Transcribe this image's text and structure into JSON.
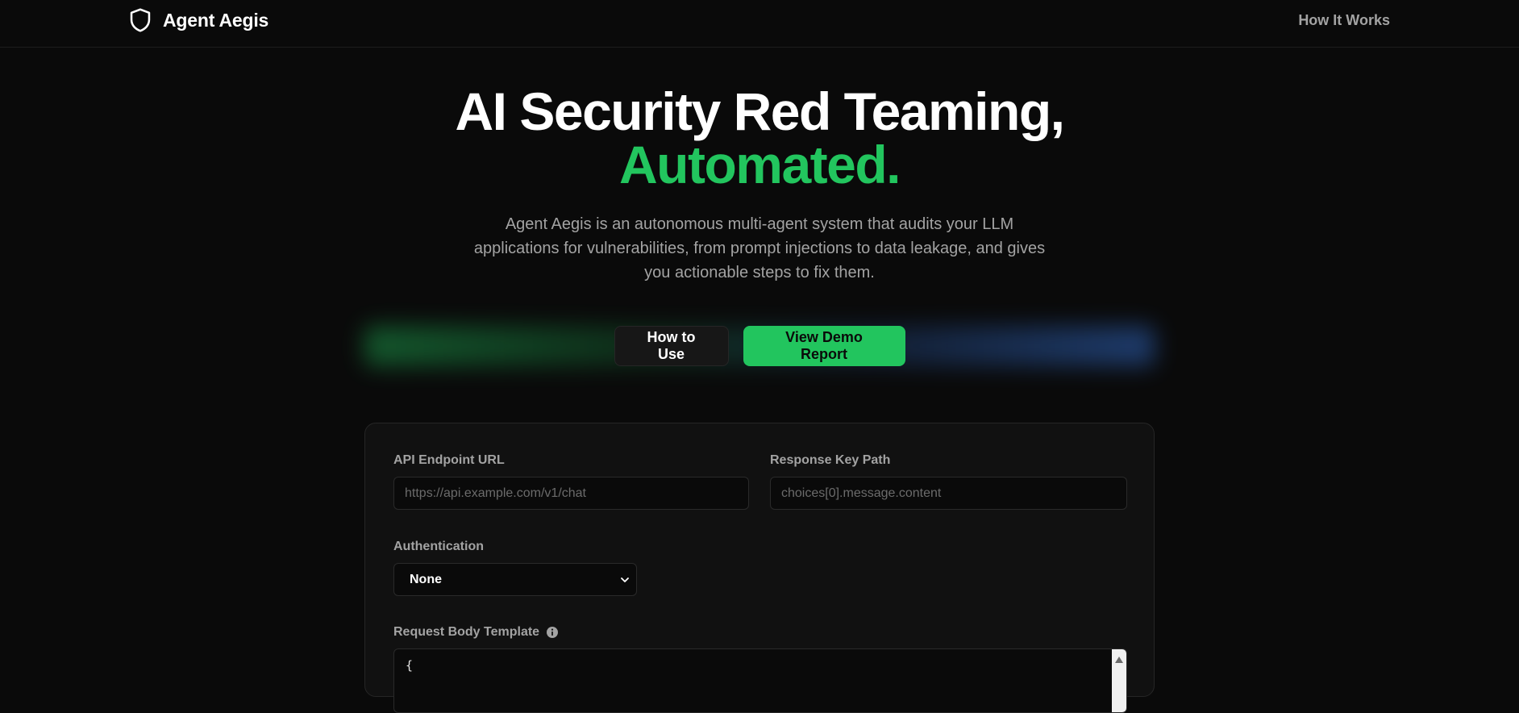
{
  "header": {
    "brand_name": "Agent Aegis",
    "brand_icon": "shield-icon",
    "nav": {
      "how_it_works": "How It Works"
    }
  },
  "hero": {
    "title_line1": "AI Security Red Teaming,",
    "title_line2": "Automated.",
    "description": "Agent Aegis is an autonomous multi-agent system that audits your LLM applications for vulnerabilities, from prompt injections to data leakage, and gives you actionable steps to fix them.",
    "buttons": {
      "how_to_use": "How to Use",
      "view_demo": "View Demo Report"
    }
  },
  "form": {
    "api_endpoint": {
      "label": "API Endpoint URL",
      "value": "",
      "placeholder": "https://api.example.com/v1/chat"
    },
    "response_key": {
      "label": "Response Key Path",
      "value": "",
      "placeholder": "choices[0].message.content"
    },
    "authentication": {
      "label": "Authentication",
      "selected": "None"
    },
    "request_body": {
      "label": "Request Body Template",
      "info_icon": "info-icon",
      "value": "{"
    }
  },
  "colors": {
    "background": "#0a0a0a",
    "accent_green": "#22c55e",
    "card": "#111111",
    "muted_text": "#a3a3a3"
  }
}
